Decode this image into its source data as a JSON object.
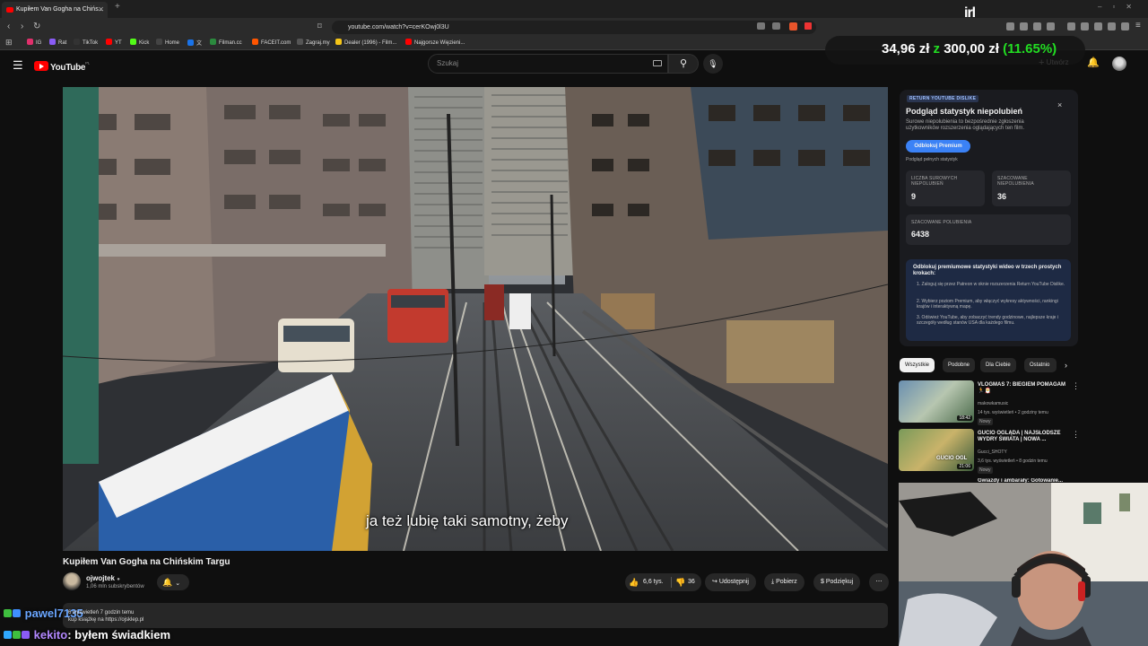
{
  "browser": {
    "tab_title": "Kupiłem Van Gogha na Chińs...",
    "url": "youtube.com/watch?v=cerKOwj0l3U",
    "bookmarks": [
      {
        "label": "IG",
        "color": "#e1306c"
      },
      {
        "label": "Rat",
        "color": "#8a5cf6"
      },
      {
        "label": "TikTok",
        "color": "#111111"
      },
      {
        "label": "YT",
        "color": "#ff0000"
      },
      {
        "label": "Kick",
        "color": "#53fc18"
      },
      {
        "label": "Home",
        "color": "#222222"
      },
      {
        "label": "文",
        "color": "#1a73e8"
      },
      {
        "label": "Filman.cc",
        "color": "#2b8a3e"
      },
      {
        "label": "FACEIT.com",
        "color": "#ff5500"
      },
      {
        "label": "Zagraj.my",
        "color": "#555555"
      },
      {
        "label": "Dealer (1996) - Film...",
        "color": "#f5c518"
      },
      {
        "label": "Najgorsze Więzieni...",
        "color": "#ff0000"
      }
    ]
  },
  "overlay": {
    "brand": "irl",
    "ticker_amount": "34,96 zł",
    "ticker_z": "z",
    "ticker_goal": "300,00 zł",
    "ticker_pct": "(11.65%)"
  },
  "yt_header": {
    "logo_text": "YouTube",
    "logo_region": "PL",
    "search_placeholder": "Szukaj",
    "create_label": "Utwórz"
  },
  "video": {
    "subtitle": "ja też lubię taki samotny, żeby",
    "title": "Kupiłem Van Gogha na Chińskim Targu",
    "channel": "ojwojtek",
    "subscribers": "1,06 mln subskrybentów",
    "likes": "6,6 tys.",
    "dislikes": "36",
    "share_label": "Udostępnij",
    "download_label": "Pobierz",
    "thanks_label": "Podziękuj"
  },
  "ryd": {
    "badge": "RETURN YOUTUBE DISLIKE",
    "title": "Podgląd statystyk niepolubień",
    "description": "Surowe niepolubienia to bezpośrednie zgłoszenia użytkowników rozszerzenia oglądających ten film.",
    "premium_button": "Odblokuj Premium",
    "full_stats_link": "Podgląd pełnych statystyk",
    "raw_dislikes_label": "LICZBA SUROWYCH NIEPOLUBIEŃ",
    "raw_dislikes": "9",
    "est_dislikes_label": "SZACOWANE NIEPOLUBIENIA",
    "est_dislikes": "36",
    "est_likes_label": "SZACOWANE POLUBIENIA",
    "est_likes": "6438",
    "unlock_title": "Odblokuj premiumowe statystyki wideo w trzech prostych krokach:",
    "unlock_steps": [
      "1. Zaloguj się przez Patreon w oknie rozszerzenia Return YouTube Dislike.",
      "2. Wybierz poziom Premium, aby włączyć wykresy aktywności, rankingi krajów i interaktywną mapę.",
      "3. Odśwież YouTube, aby zobaczyć trendy godzinowe, najlepsze kraje i szczegóły według stanów USA dla każdego filmu."
    ]
  },
  "chips": [
    "Wszystkie",
    "Podobne",
    "Dla Ciebie",
    "Ostatnio"
  ],
  "recommendations": [
    {
      "title": "VLOGMAS 7: BIEGIEM POMAGAM 🏃🎅",
      "channel": "makowkamusic",
      "meta": "14 tys. wyświetleń • 2 godziny temu",
      "new": "Nowy",
      "duration": "18:42"
    },
    {
      "title": "GUCIO OGLĄDA | NAJSŁODSZE WYDRY ŚWIATA | NOWA ...",
      "channel": "Gucci_SHOTY",
      "meta": "3,6 tys. wyświetleń • 8 godzin temu",
      "new": "Nowy",
      "duration": "21:06"
    },
    {
      "title": "Gwiazdy i ambarały: Gotowanie...",
      "channel": "",
      "meta": "",
      "new": "",
      "duration": ""
    }
  ],
  "thumb_overlay_text": "GUCIO OGL",
  "description_fragment": "6 wyświetleń  7 godzin temu",
  "chat": [
    {
      "user": "pawel7135",
      "message": ""
    },
    {
      "user": "kekito",
      "message": ": byłem świadkiem"
    }
  ],
  "chat_sub": {
    "line1": "6 wyświetleń  7 godzin temu",
    "line2": "kup książkę na https://ojsklep.pl"
  }
}
